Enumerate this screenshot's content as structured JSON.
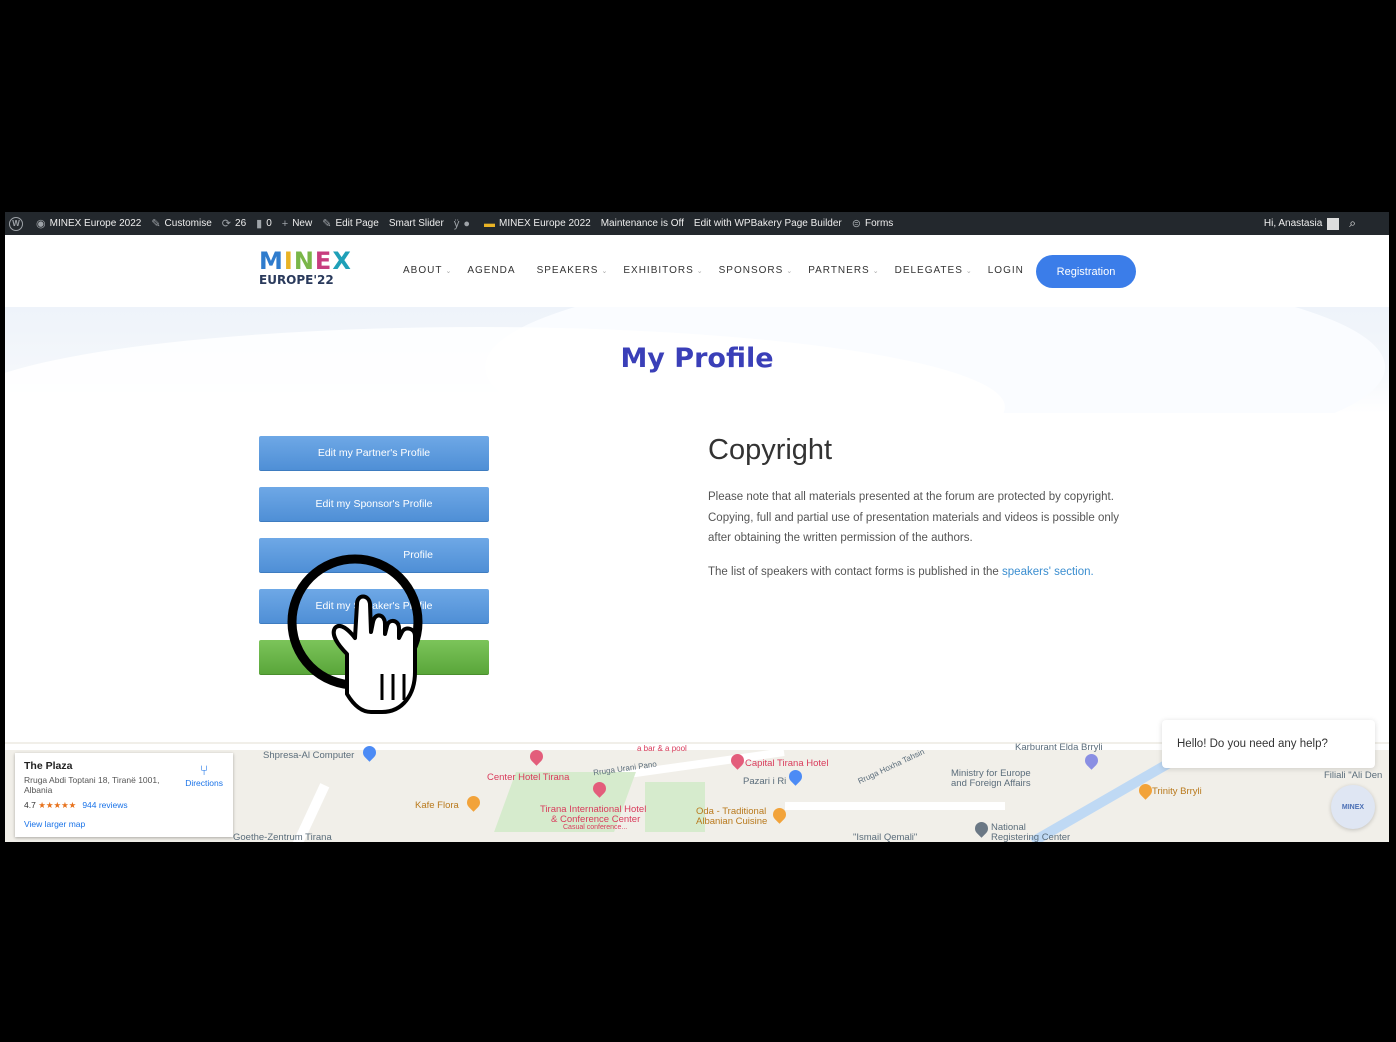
{
  "adminbar": {
    "site_name": "MINEX Europe 2022",
    "customise": "Customise",
    "updates_count": "26",
    "comments_count": "0",
    "new": "New",
    "edit_page": "Edit Page",
    "smart_slider": "Smart Slider",
    "site_name_2": "MINEX Europe 2022",
    "maintenance": "Maintenance is Off",
    "wpbakery": "Edit with WPBakery Page Builder",
    "forms": "Forms",
    "greeting": "Hi, Anastasia"
  },
  "logo": {
    "letters": [
      "M",
      "I",
      "N",
      "E",
      "X"
    ],
    "sub": "EUROPE'22"
  },
  "nav": {
    "items": [
      {
        "label": "ABOUT",
        "caret": "⌄"
      },
      {
        "label": "AGENDA",
        "caret": ""
      },
      {
        "label": "SPEAKERS",
        "caret": "⌄"
      },
      {
        "label": "EXHIBITORS",
        "caret": "⌄"
      },
      {
        "label": "SPONSORS",
        "caret": "⌄"
      },
      {
        "label": "PARTNERS",
        "caret": "⌄"
      },
      {
        "label": "DELEGATES",
        "caret": "⌄"
      },
      {
        "label": "LOGIN",
        "caret": ""
      }
    ],
    "registration": "Registration"
  },
  "hero": {
    "title": "My Profile"
  },
  "profile_buttons": [
    {
      "label": "Edit my Partner's Profile",
      "color": "#5a97dc"
    },
    {
      "label": "Edit my Sponsor's Profile",
      "color": "#5a97dc"
    },
    {
      "label": "Profile",
      "color": "#5a97dc"
    },
    {
      "label": "Edit my Speaker's Profile",
      "color": "#5a97dc"
    },
    {
      "label": "",
      "color": "#67b046"
    }
  ],
  "copyright": {
    "title": "Copyright",
    "p1": "Please note that all materials presented at the forum are protected by copyright. Copying, full and partial use of presentation materials and videos is possible only after obtaining the written permission of the authors.",
    "p2_prefix": "The list of speakers with contact forms is published in the ",
    "p2_link": "speakers' section."
  },
  "map": {
    "place_name": "The Plaza",
    "address": "Rruga Abdi Toptani 18, Tiranë 1001, Albania",
    "rating": "4.7",
    "stars": "★★★★★",
    "reviews": "944 reviews",
    "larger": "View larger map",
    "directions": "Directions",
    "labels": {
      "shpresa": "Shpresa-Al Computer",
      "center_hotel": "Center Hotel Tirana",
      "urani_pano": "Rruga Urani Pano",
      "capital_hotel": "Capital Tirana Hotel",
      "pazari": "Pazari i Ri",
      "kafe_flora": "Kafe Flora",
      "tirana_intl": "Tirana International Hotel",
      "conf_center": "& Conference Center",
      "casual": "Casual conference...",
      "oda": "Oda - Traditional",
      "albanian_cuisine": "Albanian Cuisine",
      "ministry": "Ministry for Europe",
      "foreign": "and Foreign Affairs",
      "trinity": "Trinity Brryli",
      "national": "National",
      "registering": "Registering Center",
      "goethe": "Goethe-Zentrum Tirana",
      "ismail": "\"Ismail Qemali\"",
      "hoxha": "Rruga Hoxha Tahsin",
      "bar_pool": "a bar & a pool",
      "karburant": "Karburant Elda Brryli",
      "filiali": "Filiali \"Ali Den"
    }
  },
  "chat": {
    "message": "Hello! Do you need any help?",
    "avatar_text": "MINEX"
  }
}
